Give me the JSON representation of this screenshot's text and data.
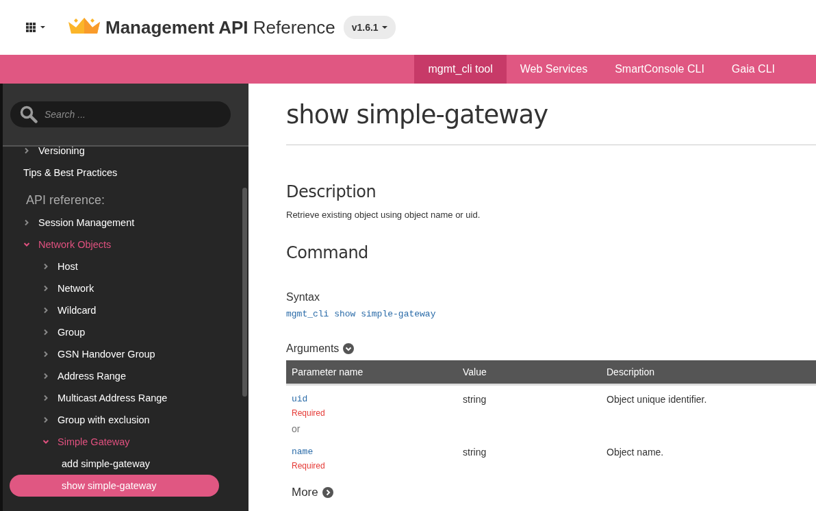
{
  "header": {
    "title": "**Management API** Reference",
    "version": "v1.6.1"
  },
  "nav_tabs": [
    {
      "label": "mgmt_cli tool",
      "selected": true
    },
    {
      "label": "Web Services",
      "selected": false
    },
    {
      "label": "SmartConsole CLI",
      "selected": false
    },
    {
      "label": "Gaia CLI",
      "selected": false
    }
  ],
  "sidebar": {
    "search": {
      "placeholder": "Search ..."
    },
    "items": [
      {
        "kind": "branch",
        "label": "Versioning",
        "expanded": false,
        "selected": false
      },
      {
        "kind": "leaf",
        "label": "Tips & Best Practices",
        "selected": false
      },
      {
        "kind": "heading",
        "label": "API reference:"
      },
      {
        "kind": "branch",
        "label": "Session Management",
        "expanded": false,
        "selected": false
      },
      {
        "kind": "branch",
        "label": "Network Objects",
        "expanded": true,
        "selected": false,
        "children": [
          {
            "kind": "branch",
            "label": "Host",
            "expanded": false,
            "selected": false
          },
          {
            "kind": "branch",
            "label": "Network",
            "expanded": false,
            "selected": false
          },
          {
            "kind": "branch",
            "label": "Wildcard",
            "expanded": false,
            "selected": false
          },
          {
            "kind": "branch",
            "label": "Group",
            "expanded": false,
            "selected": false
          },
          {
            "kind": "branch",
            "label": "GSN Handover Group",
            "expanded": false,
            "selected": false
          },
          {
            "kind": "branch",
            "label": "Address Range",
            "expanded": false,
            "selected": false
          },
          {
            "kind": "branch",
            "label": "Multicast Address Range",
            "expanded": false,
            "selected": false
          },
          {
            "kind": "branch",
            "label": "Group with exclusion",
            "expanded": false,
            "selected": false
          },
          {
            "kind": "branch",
            "label": "Simple Gateway",
            "expanded": true,
            "selected": false,
            "children": [
              {
                "kind": "leaf",
                "label": "add simple-gateway",
                "selected": false
              },
              {
                "kind": "leaf",
                "label": "show simple-gateway",
                "selected": true
              }
            ]
          }
        ]
      }
    ]
  },
  "content": {
    "title": "show simple-gateway",
    "description_heading": "Description",
    "description": "Retrieve existing object using object name or uid.",
    "command_heading": "Command",
    "syntax_label": "Syntax",
    "syntax": "mgmt_cli show simple-gateway",
    "arguments_label": "Arguments",
    "arguments_expanded": true,
    "table": {
      "columns": [
        "Parameter name",
        "Value",
        "Description"
      ],
      "rows": [
        {
          "kind": "param",
          "name": "uid",
          "required": "Required",
          "value": "string",
          "description": "Object unique identifier."
        },
        {
          "kind": "separator",
          "text": "or"
        },
        {
          "kind": "param",
          "name": "name",
          "required": "Required",
          "value": "string",
          "description": "Object name."
        }
      ]
    },
    "more_label": "More",
    "more_expanded": false
  }
}
